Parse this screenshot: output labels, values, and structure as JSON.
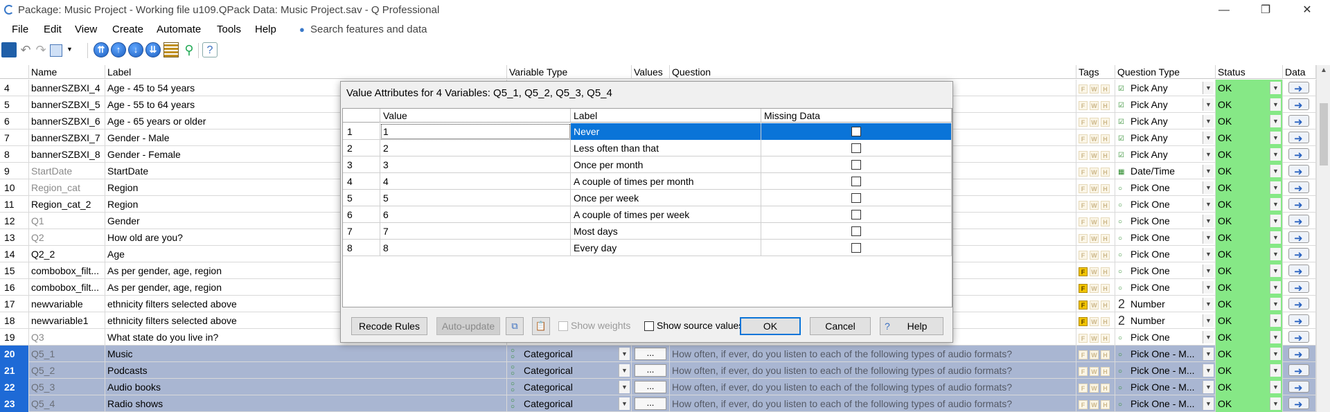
{
  "window": {
    "title": "Package: Music Project - Working file u109.QPack  Data: Music Project.sav - Q Professional",
    "minimize_icon": "—",
    "restore_icon": "❐",
    "close_icon": "✕"
  },
  "menu": {
    "items": [
      "File",
      "Edit",
      "View",
      "Create",
      "Automate",
      "Tools",
      "Help"
    ],
    "search_placeholder": "Search features and data"
  },
  "grid": {
    "headers": {
      "name": "Name",
      "label": "Label",
      "variable_type": "Variable Type",
      "values": "Values",
      "question": "Question",
      "tags": "Tags",
      "question_type": "Question Type",
      "status": "Status",
      "data": "Data"
    },
    "rows": [
      {
        "num": "4",
        "name": "bannerSZBXI_4",
        "label": "Age - 45 to 54 years",
        "qtype": "Pick Any",
        "status": "OK"
      },
      {
        "num": "5",
        "name": "bannerSZBXI_5",
        "label": "Age - 55 to 64 years",
        "qtype": "Pick Any",
        "status": "OK"
      },
      {
        "num": "6",
        "name": "bannerSZBXI_6",
        "label": "Age - 65 years or older",
        "qtype": "Pick Any",
        "status": "OK"
      },
      {
        "num": "7",
        "name": "bannerSZBXI_7",
        "label": "Gender - Male",
        "qtype": "Pick Any",
        "status": "OK"
      },
      {
        "num": "8",
        "name": "bannerSZBXI_8",
        "label": "Gender - Female",
        "qtype": "Pick Any",
        "status": "OK"
      },
      {
        "num": "9",
        "name": "StartDate",
        "label": "StartDate",
        "qtype": "Date/Time",
        "status": "OK"
      },
      {
        "num": "10",
        "name": "Region_cat",
        "label": "Region",
        "qtype": "Pick One",
        "status": "OK"
      },
      {
        "num": "11",
        "name": "Region_cat_2",
        "label": "Region",
        "qtype": "Pick One",
        "status": "OK"
      },
      {
        "num": "12",
        "name": "Q1",
        "label": "Gender",
        "qtype": "Pick One",
        "status": "OK"
      },
      {
        "num": "13",
        "name": "Q2",
        "label": "How old are you?",
        "qtype": "Pick One",
        "status": "OK"
      },
      {
        "num": "14",
        "name": "Q2_2",
        "label": "Age",
        "qtype": "Pick One",
        "status": "OK"
      },
      {
        "num": "15",
        "name": "combobox_filt...",
        "label": "As per gender, age, region",
        "qtype": "Pick One",
        "status": "OK"
      },
      {
        "num": "16",
        "name": "combobox_filt...",
        "label": " As per gender, age, region",
        "qtype": "Pick One",
        "status": "OK"
      },
      {
        "num": "17",
        "name": "newvariable",
        "label": "ethnicity filters selected above",
        "qtype": "Number",
        "status": "OK"
      },
      {
        "num": "18",
        "name": "newvariable1",
        "label": "ethnicity filters selected above",
        "qtype": "Number",
        "status": "OK"
      },
      {
        "num": "19",
        "name": "Q3",
        "label": "What state do you live in?",
        "qtype": "Pick One",
        "status": "OK"
      },
      {
        "num": "20",
        "name": "Q5_1",
        "label": "Music",
        "vtype": "Categorical",
        "values": "...",
        "question": "How often, if ever, do you listen to each of the following types of audio formats?",
        "qtype": "Pick One - M...",
        "status": "OK"
      },
      {
        "num": "21",
        "name": "Q5_2",
        "label": "Podcasts",
        "vtype": "Categorical",
        "values": "...",
        "question": "How often, if ever, do you listen to each of the following types of audio formats?",
        "qtype": "Pick One - M...",
        "status": "OK"
      },
      {
        "num": "22",
        "name": "Q5_3",
        "label": "Audio books",
        "vtype": "Categorical",
        "values": "...",
        "question": "How often, if ever, do you listen to each of the following types of audio formats?",
        "qtype": "Pick One - M...",
        "status": "OK"
      },
      {
        "num": "23",
        "name": "Q5_4",
        "label": "Radio shows",
        "vtype": "Categorical",
        "values": "...",
        "question": "How often, if ever, do you listen to each of the following types of audio formats?",
        "qtype": "Pick One - M...",
        "status": "OK"
      }
    ],
    "tag_letters": [
      "F",
      "W",
      "H"
    ],
    "number_icon": "2"
  },
  "dialog": {
    "title": "Value Attributes for 4 Variables: Q5_1, Q5_2, Q5_3, Q5_4",
    "headers": {
      "value": "Value",
      "label": "Label",
      "missing": "Missing Data"
    },
    "rows": [
      {
        "rn": "1",
        "value": "1",
        "label": "Never"
      },
      {
        "rn": "2",
        "value": "2",
        "label": "Less often than that"
      },
      {
        "rn": "3",
        "value": "3",
        "label": "Once per month"
      },
      {
        "rn": "4",
        "value": "4",
        "label": "A couple of times per month"
      },
      {
        "rn": "5",
        "value": "5",
        "label": "Once per week"
      },
      {
        "rn": "6",
        "value": "6",
        "label": "A couple of times per week"
      },
      {
        "rn": "7",
        "value": "7",
        "label": "Most days"
      },
      {
        "rn": "8",
        "value": "8",
        "label": "Every day"
      }
    ],
    "buttons": {
      "recode": "Recode Rules",
      "autoupdate": "Auto-update",
      "show_weights": "Show weights",
      "show_source": "Show source values",
      "ok": "OK",
      "cancel": "Cancel",
      "help": "Help"
    }
  },
  "colors": {
    "status_ok": "#86e886",
    "selection": "#0a74d8",
    "selected_row": "#a9b6d2"
  }
}
